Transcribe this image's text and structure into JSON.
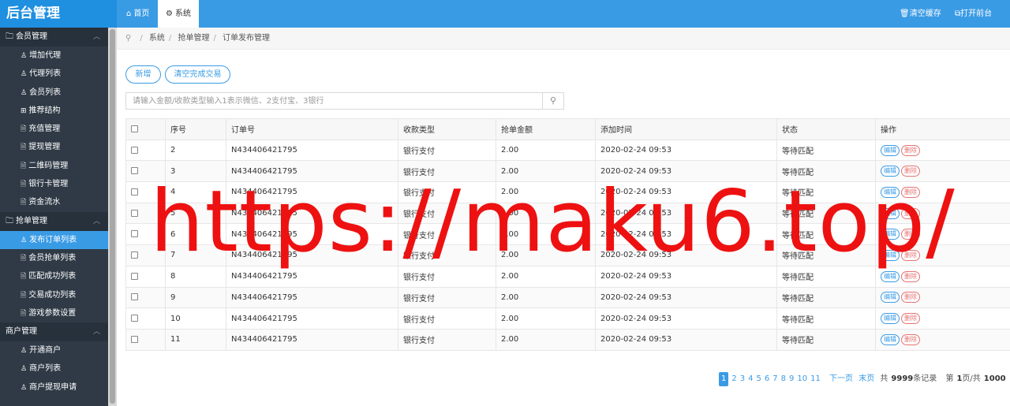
{
  "header": {
    "logo": "后台管理",
    "tabs": [
      {
        "icon": "⌂",
        "label": "首页"
      },
      {
        "icon": "⚙",
        "label": "系统"
      }
    ],
    "clear_cache": "清空缓存",
    "open_front": "打开前台"
  },
  "sidebar": {
    "groups": [
      {
        "label": "会员管理",
        "items": [
          "增加代理",
          "代理列表",
          "会员列表",
          "推荐结构",
          "充值管理",
          "提现管理",
          "二维码管理",
          "银行卡管理",
          "资金流水"
        ]
      },
      {
        "label": "抢单管理",
        "items": [
          "发布订单列表",
          "会员抢单列表",
          "匹配成功列表",
          "交易成功列表",
          "游戏参数设置"
        ]
      },
      {
        "label": "商户管理",
        "items": [
          "开通商户",
          "商户列表",
          "商户提现申请"
        ]
      }
    ]
  },
  "breadcrumb": [
    "系统",
    "抢单管理",
    "订单发布管理"
  ],
  "buttons": {
    "add": "新增",
    "clear": "清空完成交易"
  },
  "search": {
    "placeholder": "请输入金额/收款类型输入1表示微信、2支付宝、3银行",
    "value": ""
  },
  "table": {
    "headers": [
      "序号",
      "订单号",
      "收款类型",
      "抢单金额",
      "添加时间",
      "状态",
      "操作"
    ],
    "rows": [
      [
        "2",
        "N434406421795",
        "银行支付",
        "2.00",
        "2020-02-24 09:53",
        "等待匹配"
      ],
      [
        "3",
        "N434406421795",
        "银行支付",
        "2.00",
        "2020-02-24 09:53",
        "等待匹配"
      ],
      [
        "4",
        "N434406421795",
        "银行支付",
        "2.00",
        "2020-02-24 09:53",
        "等待匹配"
      ],
      [
        "5",
        "N434406421795",
        "银行支付",
        "2.00",
        "2020-02-24 09:53",
        "等待匹配"
      ],
      [
        "6",
        "N434406421795",
        "银行支付",
        "2.00",
        "2020-02-24 09:53",
        "等待匹配"
      ],
      [
        "7",
        "N434406421795",
        "银行支付",
        "2.00",
        "2020-02-24 09:53",
        "等待匹配"
      ],
      [
        "8",
        "N434406421795",
        "银行支付",
        "2.00",
        "2020-02-24 09:53",
        "等待匹配"
      ],
      [
        "9",
        "N434406421795",
        "银行支付",
        "2.00",
        "2020-02-24 09:53",
        "等待匹配"
      ],
      [
        "10",
        "N434406421795",
        "银行支付",
        "2.00",
        "2020-02-24 09:53",
        "等待匹配"
      ],
      [
        "11",
        "N434406421795",
        "银行支付",
        "2.00",
        "2020-02-24 09:53",
        "等待匹配"
      ]
    ],
    "edit_label": "编辑",
    "delete_label": "删除"
  },
  "pager": {
    "pages": [
      "1",
      "2",
      "3",
      "4",
      "5",
      "6",
      "7",
      "8",
      "9",
      "10",
      "11"
    ],
    "current": "1",
    "next": "下一页",
    "last": "末页",
    "total_prefix": "共",
    "total_count": "9999",
    "total_suffix": "条记录",
    "page_prefix": "第",
    "page_current": "1",
    "page_mid": "页/共",
    "page_total": "1000"
  },
  "watermark": "https://maku6.top/",
  "colors": {
    "primary": "#3a9be5",
    "sidebar": "#2f3a46",
    "danger": "#e57373",
    "watermark": "#ee1111"
  }
}
